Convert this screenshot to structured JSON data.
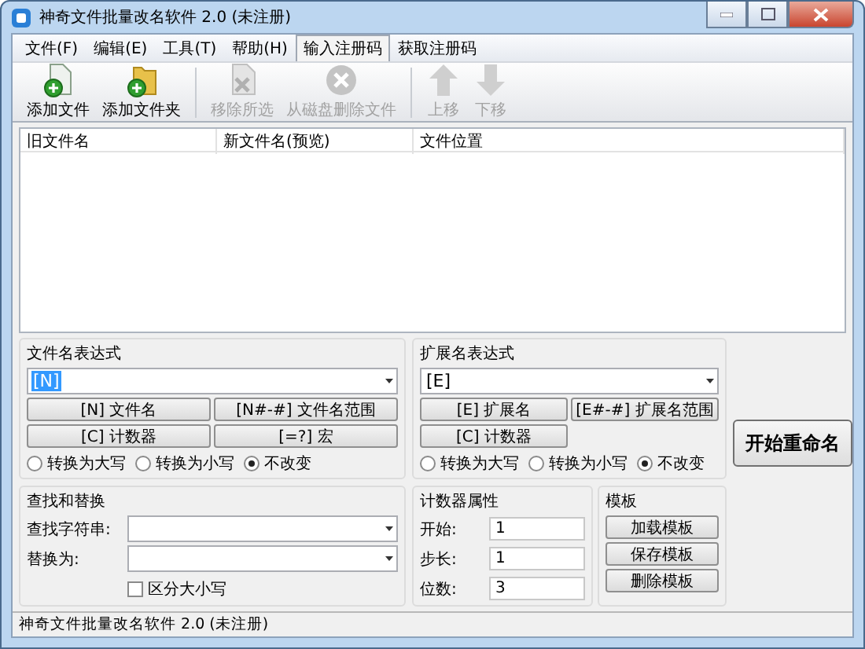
{
  "window": {
    "title": "神奇文件批量改名软件 2.0 (未注册)"
  },
  "menu": [
    {
      "label": "文件(F)",
      "selected": false
    },
    {
      "label": "编辑(E)",
      "selected": false
    },
    {
      "label": "工具(T)",
      "selected": false
    },
    {
      "label": "帮助(H)",
      "selected": false
    },
    {
      "label": "输入注册码",
      "selected": true
    },
    {
      "label": "获取注册码",
      "selected": false
    }
  ],
  "toolbar": [
    {
      "kind": "add-file",
      "label": "添加文件",
      "disabled": false
    },
    {
      "kind": "add-folder",
      "label": "添加文件夹",
      "disabled": false
    },
    {
      "kind": "remove",
      "label": "移除所选",
      "disabled": true
    },
    {
      "kind": "delete",
      "label": "从磁盘删除文件",
      "disabled": true
    },
    {
      "kind": "up",
      "label": "上移",
      "disabled": true
    },
    {
      "kind": "down",
      "label": "下移",
      "disabled": true
    }
  ],
  "table": {
    "columns": [
      "旧文件名",
      "新文件名(预览)",
      "文件位置"
    ]
  },
  "filename_expression": {
    "title": "文件名表达式",
    "value": "[N]",
    "buttons": [
      "[N] 文件名",
      "[N#-#] 文件名范围",
      "[C] 计数器",
      "[=?] 宏"
    ],
    "case_options": [
      {
        "label": "转换为大写",
        "selected": false
      },
      {
        "label": "转换为小写",
        "selected": false
      },
      {
        "label": "不改变",
        "selected": true
      }
    ]
  },
  "extension_expression": {
    "title": "扩展名表达式",
    "value": "[E]",
    "buttons": [
      "[E] 扩展名",
      "[E#-#] 扩展名范围",
      "[C] 计数器"
    ],
    "case_options": [
      {
        "label": "转换为大写",
        "selected": false
      },
      {
        "label": "转换为小写",
        "selected": false
      },
      {
        "label": "不改变",
        "selected": true
      }
    ]
  },
  "start_button": "开始重命名",
  "find_replace": {
    "title": "查找和替换",
    "find_label": "查找字符串:",
    "replace_label": "替换为:",
    "case_sensitive": {
      "label": "区分大小写",
      "checked": false
    }
  },
  "counter": {
    "title": "计数器属性",
    "fields": [
      {
        "label": "开始:",
        "value": "1"
      },
      {
        "label": "步长:",
        "value": "1"
      },
      {
        "label": "位数:",
        "value": "3"
      }
    ]
  },
  "template": {
    "title": "模板",
    "buttons": [
      "加载模板",
      "保存模板",
      "删除模板"
    ]
  },
  "status_bar": "神奇文件批量改名软件 2.0 (未注册)"
}
